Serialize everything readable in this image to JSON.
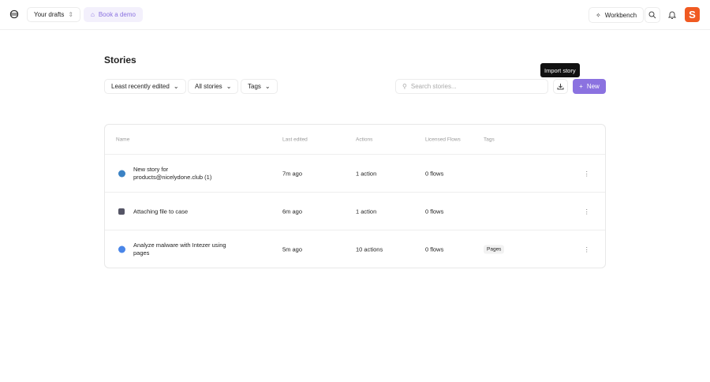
{
  "topbar": {
    "drafts": "Your drafts",
    "demo": "Book a demo",
    "workbench": "Workbench"
  },
  "page": {
    "title": "Stories"
  },
  "filters": {
    "sort": "Least recently edited",
    "scope": "All stories",
    "tags": "Tags"
  },
  "search": {
    "placeholder": "Search stories..."
  },
  "tooltip": "Import story",
  "new_label": "New",
  "table": {
    "headers": [
      "Name",
      "Last edited",
      "Actions",
      "Licensed Flows",
      "Tags"
    ],
    "rows": [
      {
        "name": "New story for products@nicelydone.club (1)",
        "edited": "7m ago",
        "actions": "1 action",
        "flows": "0 flows",
        "tag": ""
      },
      {
        "name": "Attaching file to case",
        "edited": "6m ago",
        "actions": "1 action",
        "flows": "0 flows",
        "tag": ""
      },
      {
        "name": "Analyze malware with Intezer using pages",
        "edited": "5m ago",
        "actions": "10 actions",
        "flows": "0 flows",
        "tag": "Pages"
      }
    ]
  },
  "colors": {
    "accent": "#8b72e0",
    "brand": "#f05a22"
  }
}
